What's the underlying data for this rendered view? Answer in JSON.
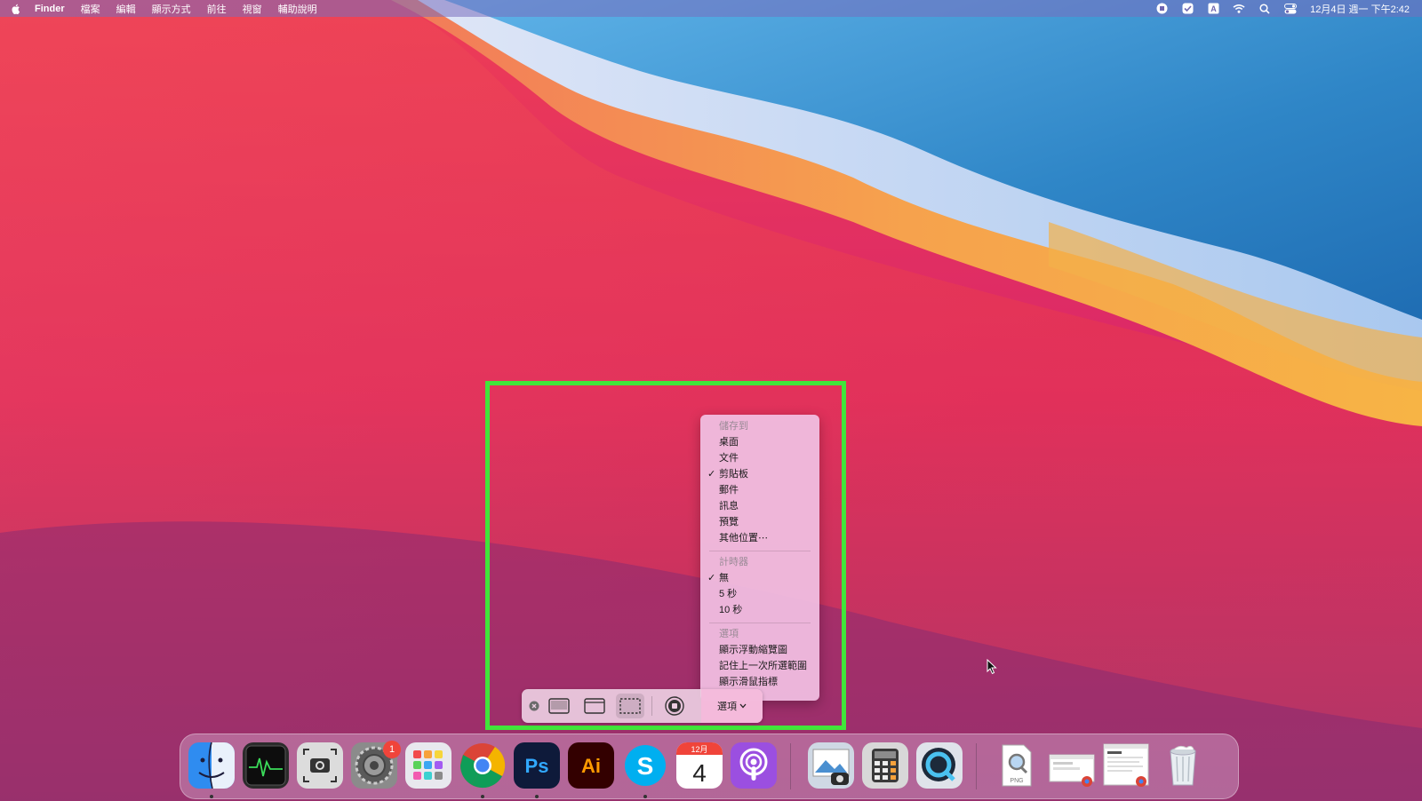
{
  "menubar": {
    "app_name": "Finder",
    "items": [
      "檔案",
      "編輯",
      "顯示方式",
      "前往",
      "視窗",
      "輔助說明"
    ],
    "status_icons": [
      "screen-record-stop-icon",
      "checkmark-status-icon",
      "input-method-icon",
      "wifi-icon",
      "spotlight-search-icon",
      "control-center-icon"
    ],
    "clock": "12月4日 週一 下午2:42"
  },
  "toolbar": {
    "options_label": "選項",
    "tools": [
      "close-icon",
      "capture-entire-screen-icon",
      "capture-window-icon",
      "capture-selection-icon",
      "record-icon"
    ]
  },
  "options_menu": {
    "save_to_header": "儲存到",
    "save_to": [
      {
        "label": "桌面",
        "checked": false
      },
      {
        "label": "文件",
        "checked": false
      },
      {
        "label": "剪貼板",
        "checked": true
      },
      {
        "label": "郵件",
        "checked": false
      },
      {
        "label": "訊息",
        "checked": false
      },
      {
        "label": "預覽",
        "checked": false
      },
      {
        "label": "其他位置⋯",
        "checked": false
      }
    ],
    "timer_header": "計時器",
    "timer": [
      {
        "label": "無",
        "checked": true
      },
      {
        "label": "5 秒",
        "checked": false
      },
      {
        "label": "10 秒",
        "checked": false
      }
    ],
    "options_header": "選項",
    "options": [
      {
        "label": "顯示浮動縮覽圖",
        "checked": false
      },
      {
        "label": "記住上一次所選範圍",
        "checked": false
      },
      {
        "label": "顯示滑鼠指標",
        "checked": false
      }
    ],
    "check_mark": "✓"
  },
  "dock": {
    "apps": [
      "Finder",
      "Activity Monitor",
      "Screenshot",
      "System Preferences",
      "Launchpad",
      "Google Chrome",
      "Photoshop",
      "Illustrator",
      "Skype",
      "Calendar",
      "Podcasts",
      "Preview",
      "Calculator",
      "QuickTime Player",
      "PNG Document",
      "Chrome Screenshot 1",
      "Chrome Screenshot 2",
      "Trash"
    ],
    "system_prefs_badge": "1",
    "photoshop_label": "Ps",
    "illustrator_label": "Ai",
    "skype_label": "S",
    "calendar_month": "12月",
    "calendar_day": "4",
    "png_label": "PNG"
  },
  "colors": {
    "highlight": "#41e53a",
    "badge": "#f0443a"
  }
}
